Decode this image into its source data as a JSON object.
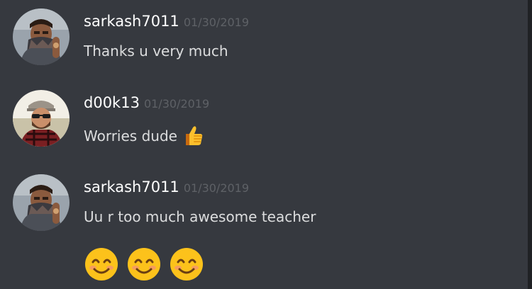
{
  "messages": [
    {
      "username": "sarkash7011",
      "timestamp": "01/30/2019",
      "text": "Thanks u very much",
      "avatar": "masked-man-avatar"
    },
    {
      "username": "d00k13",
      "timestamp": "01/30/2019",
      "text": "Worries dude",
      "avatar": "bearded-man-avatar",
      "emoji": "thumbs-up"
    },
    {
      "username": "sarkash7011",
      "timestamp": "01/30/2019",
      "text": "Uu r too much awesome teacher",
      "avatar": "masked-man-avatar",
      "emojis": [
        "smiling-face",
        "smiling-face",
        "smiling-face"
      ]
    }
  ],
  "colors": {
    "background": "#36393f",
    "username": "#ffffff",
    "timestamp": "#5e6166",
    "text": "#dcddde"
  }
}
